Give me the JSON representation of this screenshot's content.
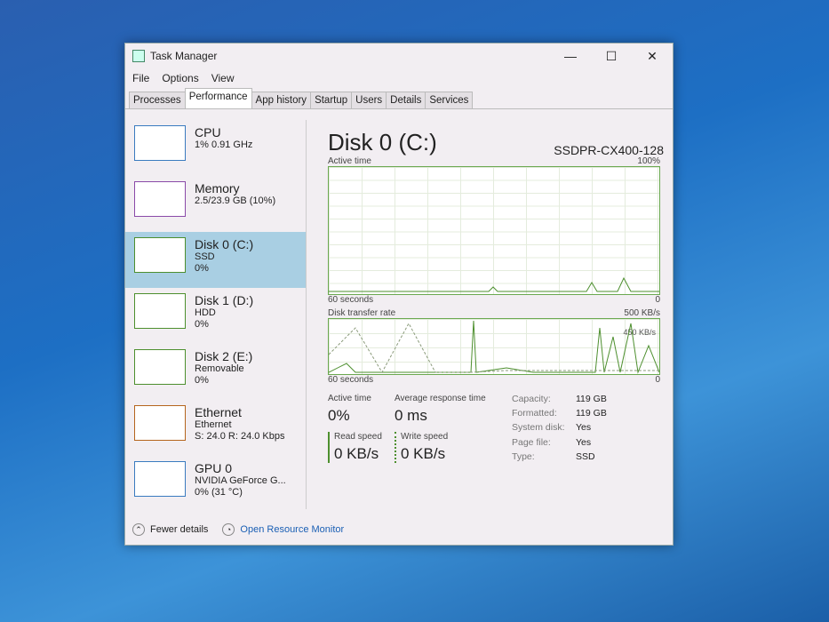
{
  "window": {
    "title": "Task Manager",
    "minimize": "—",
    "maximize": "☐",
    "close": "✕"
  },
  "menu": [
    "File",
    "Options",
    "View"
  ],
  "tabs": [
    "Processes",
    "Performance",
    "App history",
    "Startup",
    "Users",
    "Details",
    "Services"
  ],
  "active_tab": "Performance",
  "sidebar": [
    {
      "name": "CPU",
      "sub1": "1% 0.91 GHz",
      "sub2": ""
    },
    {
      "name": "Memory",
      "sub1": "2.5/23.9 GB (10%)",
      "sub2": ""
    },
    {
      "name": "Disk 0 (C:)",
      "sub1": "SSD",
      "sub2": "0%"
    },
    {
      "name": "Disk 1 (D:)",
      "sub1": "HDD",
      "sub2": "0%"
    },
    {
      "name": "Disk 2 (E:)",
      "sub1": "Removable",
      "sub2": "0%"
    },
    {
      "name": "Ethernet",
      "sub1": "Ethernet",
      "sub2": "S: 24.0 R: 24.0 Kbps"
    },
    {
      "name": "GPU 0",
      "sub1": "NVIDIA GeForce G...",
      "sub2": "0% (31 °C)"
    }
  ],
  "detail": {
    "title": "Disk 0 (C:)",
    "model": "SSDPR-CX400-128",
    "graph1": {
      "label": "Active time",
      "max": "100%",
      "xlabel": "60 seconds",
      "min": "0"
    },
    "graph2": {
      "label": "Disk transfer rate",
      "max": "500 KB/s",
      "mid": "450 KB/s",
      "xlabel": "60 seconds",
      "min": "0"
    },
    "active_time_label": "Active time",
    "active_time": "0%",
    "resp_label": "Average response time",
    "resp": "0 ms",
    "read_label": "Read speed",
    "read": "0 KB/s",
    "write_label": "Write speed",
    "write": "0 KB/s",
    "props": [
      [
        "Capacity:",
        "119 GB"
      ],
      [
        "Formatted:",
        "119 GB"
      ],
      [
        "System disk:",
        "Yes"
      ],
      [
        "Page file:",
        "Yes"
      ],
      [
        "Type:",
        "SSD"
      ]
    ]
  },
  "footer": {
    "fewer": "Fewer details",
    "monitor": "Open Resource Monitor"
  }
}
